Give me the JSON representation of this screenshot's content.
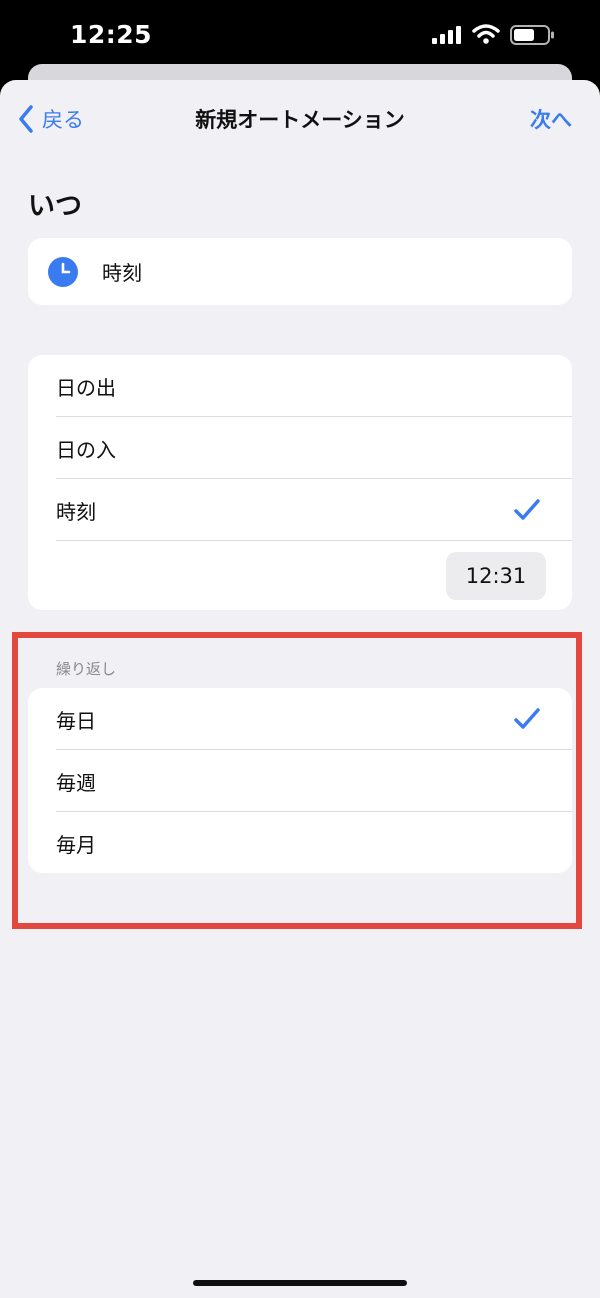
{
  "status_bar": {
    "time": "12:25",
    "signal_icon": "cellular-signal-icon",
    "wifi_icon": "wifi-icon",
    "battery_icon": "battery-icon"
  },
  "nav": {
    "back_label": "戻る",
    "title": "新規オートメーション",
    "next_label": "次へ",
    "accent_color": "#3a7cf0"
  },
  "when": {
    "title": "いつ",
    "trigger_icon": "clock-icon",
    "trigger_label": "時刻"
  },
  "time_options": [
    {
      "label": "日の出",
      "selected": false
    },
    {
      "label": "日の入",
      "selected": false
    },
    {
      "label": "時刻",
      "selected": true
    }
  ],
  "selected_time": "12:31",
  "repeat": {
    "header": "繰り返し",
    "options": [
      {
        "label": "毎日",
        "selected": true
      },
      {
        "label": "毎週",
        "selected": false
      },
      {
        "label": "毎月",
        "selected": false
      }
    ]
  },
  "highlight_color": "#e2483e"
}
